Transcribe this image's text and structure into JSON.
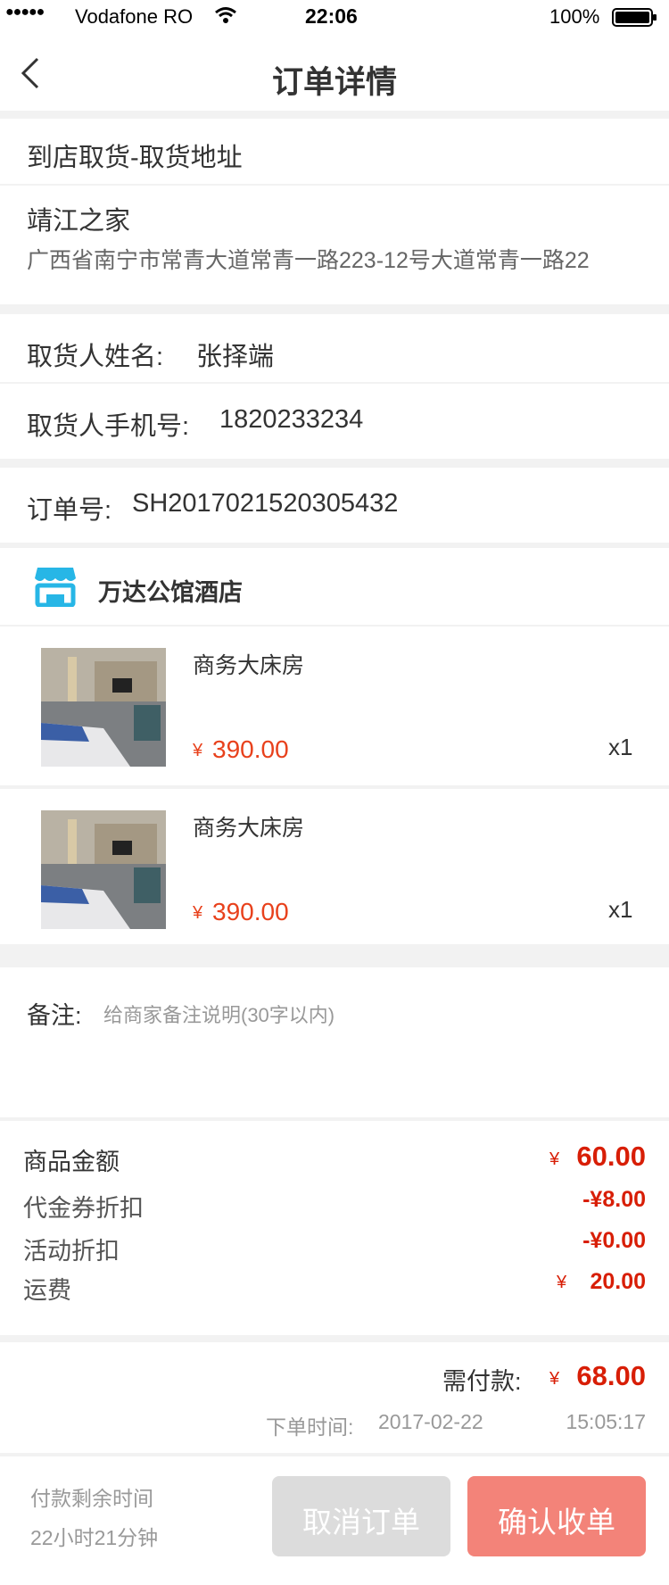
{
  "status_bar": {
    "signal": "●●●●●",
    "carrier": "Vodafone RO",
    "time": "22:06",
    "battery_pct": "100%"
  },
  "nav": {
    "title": "订单详情"
  },
  "pickup": {
    "section_title": "到店取货-取货地址",
    "store_name": "靖江之家",
    "address": "广西省南宁市常青大道常青一路223-12号大道常青一路22"
  },
  "contact": {
    "name_label": "取货人姓名:",
    "name_value": "张择端",
    "phone_label": "取货人手机号:",
    "phone_value": "1820233234"
  },
  "order": {
    "number_label": "订单号:",
    "number_value": "SH2017021520305432"
  },
  "shop": {
    "name": "万达公馆酒店",
    "icon": "store-icon"
  },
  "items": [
    {
      "name": "商务大床房",
      "currency": "¥",
      "price": "390.00",
      "qty": "x1"
    },
    {
      "name": "商务大床房",
      "currency": "¥",
      "price": "390.00",
      "qty": "x1"
    }
  ],
  "remark": {
    "label": "备注:",
    "placeholder": "给商家备注说明(30字以内)"
  },
  "summary": {
    "goods_label": "商品金额",
    "goods_currency": "¥",
    "goods_value": "60.00",
    "voucher_label": "代金券折扣",
    "voucher_value": "-¥8.00",
    "activity_label": "活动折扣",
    "activity_value": "-¥0.00",
    "shipping_label": "运费",
    "shipping_currency": "¥",
    "shipping_value": "20.00"
  },
  "payment": {
    "due_label": "需付款:",
    "due_currency": "¥",
    "due_value": "68.00",
    "order_time_label": "下单时间:",
    "order_date": "2017-02-22",
    "order_time": "15:05:17"
  },
  "footer": {
    "remaining_label": "付款剩余时间",
    "remaining_value": "22小时21分钟",
    "cancel_label": "取消订单",
    "confirm_label": "确认收单"
  },
  "colors": {
    "accent_red": "#e8411c",
    "price_red": "#d81e06",
    "confirm_button": "#f38379",
    "cancel_button": "#dcdcdc",
    "store_icon": "#27b6e6"
  }
}
